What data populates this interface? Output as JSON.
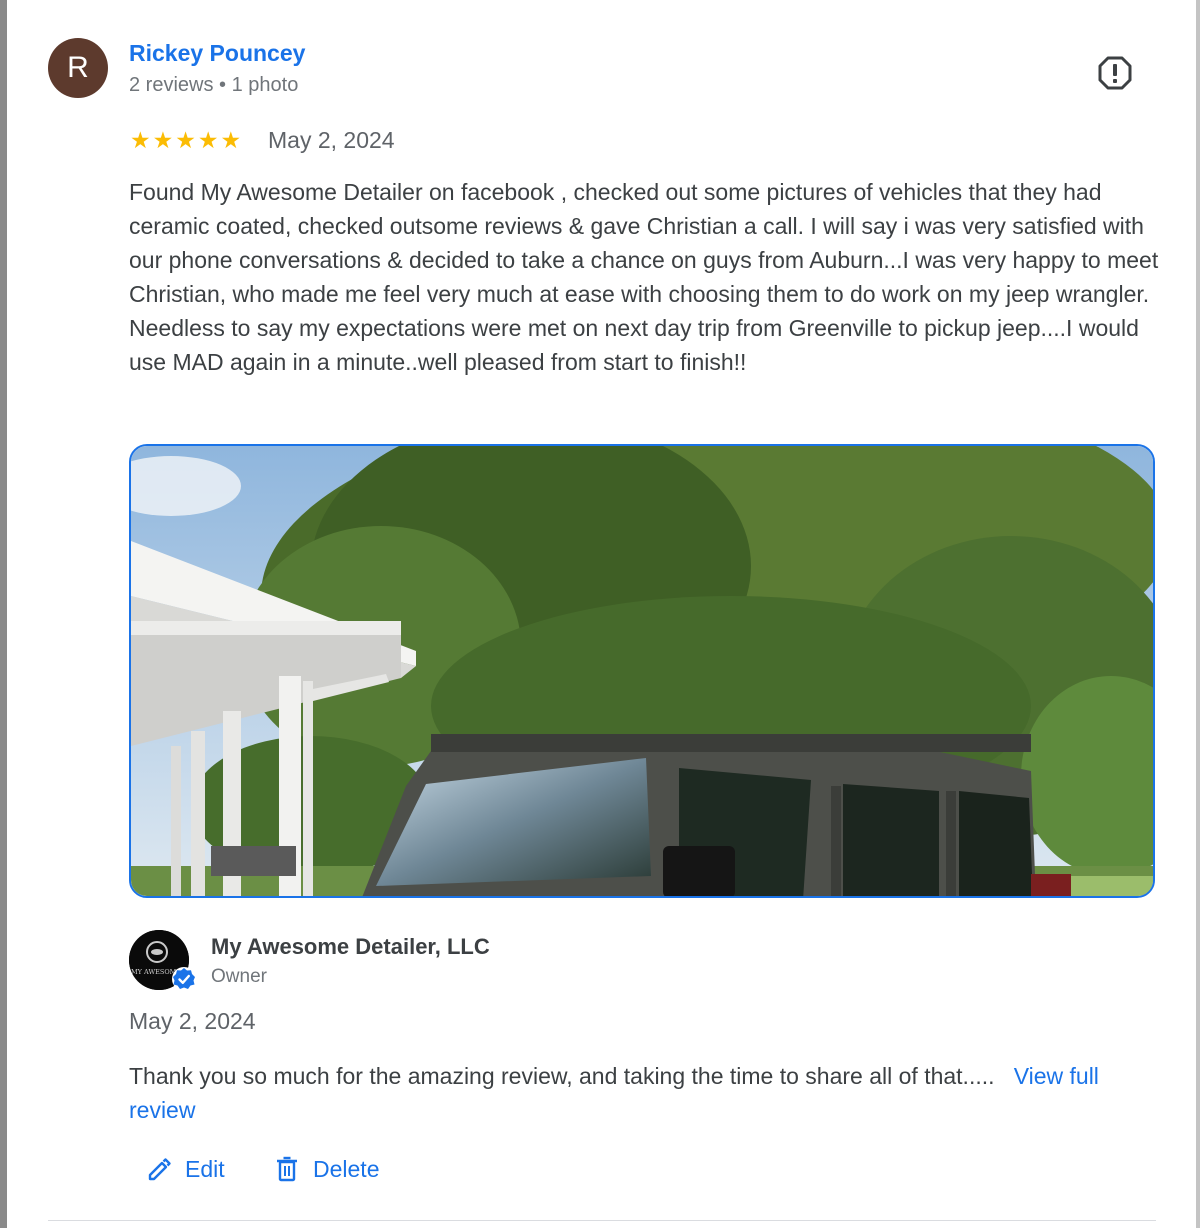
{
  "review": {
    "avatar_initial": "R",
    "author_name": "Rickey Pouncey",
    "author_meta": "2 reviews • 1 photo",
    "rating": 5,
    "stars": "★★★★★",
    "date": "May 2, 2024",
    "text": "Found My Awesome Detailer on facebook , checked out some pictures of vehicles that they had ceramic coated, checked outsome reviews & gave Christian a call. I will say i was very satisfied with our phone conversations & decided to take a chance on guys from Auburn...I was very happy to meet Christian, who made me feel very much at ease with choosing them to do work on my jeep wrangler. Needless to say my expectations were met on next day trip from Greenville to pickup jeep....I would use MAD again in a minute..well pleased from start to finish!!",
    "report_icon": "report-icon",
    "avatar_color": "#5d3a2d"
  },
  "owner_reply": {
    "name": "My Awesome Detailer, LLC",
    "role": "Owner",
    "logo_text": "MY AWESOME DE",
    "date": "May 2, 2024",
    "text": "Thank you so much for the amazing review, and taking the time to share all of that.....",
    "view_link": "View full review",
    "verified_icon": "verified-check-icon"
  },
  "actions": {
    "edit_label": "Edit",
    "delete_label": "Delete"
  },
  "colors": {
    "link": "#1a73e8",
    "star": "#fbbc04",
    "text": "#3c4043",
    "muted": "#70757a"
  }
}
